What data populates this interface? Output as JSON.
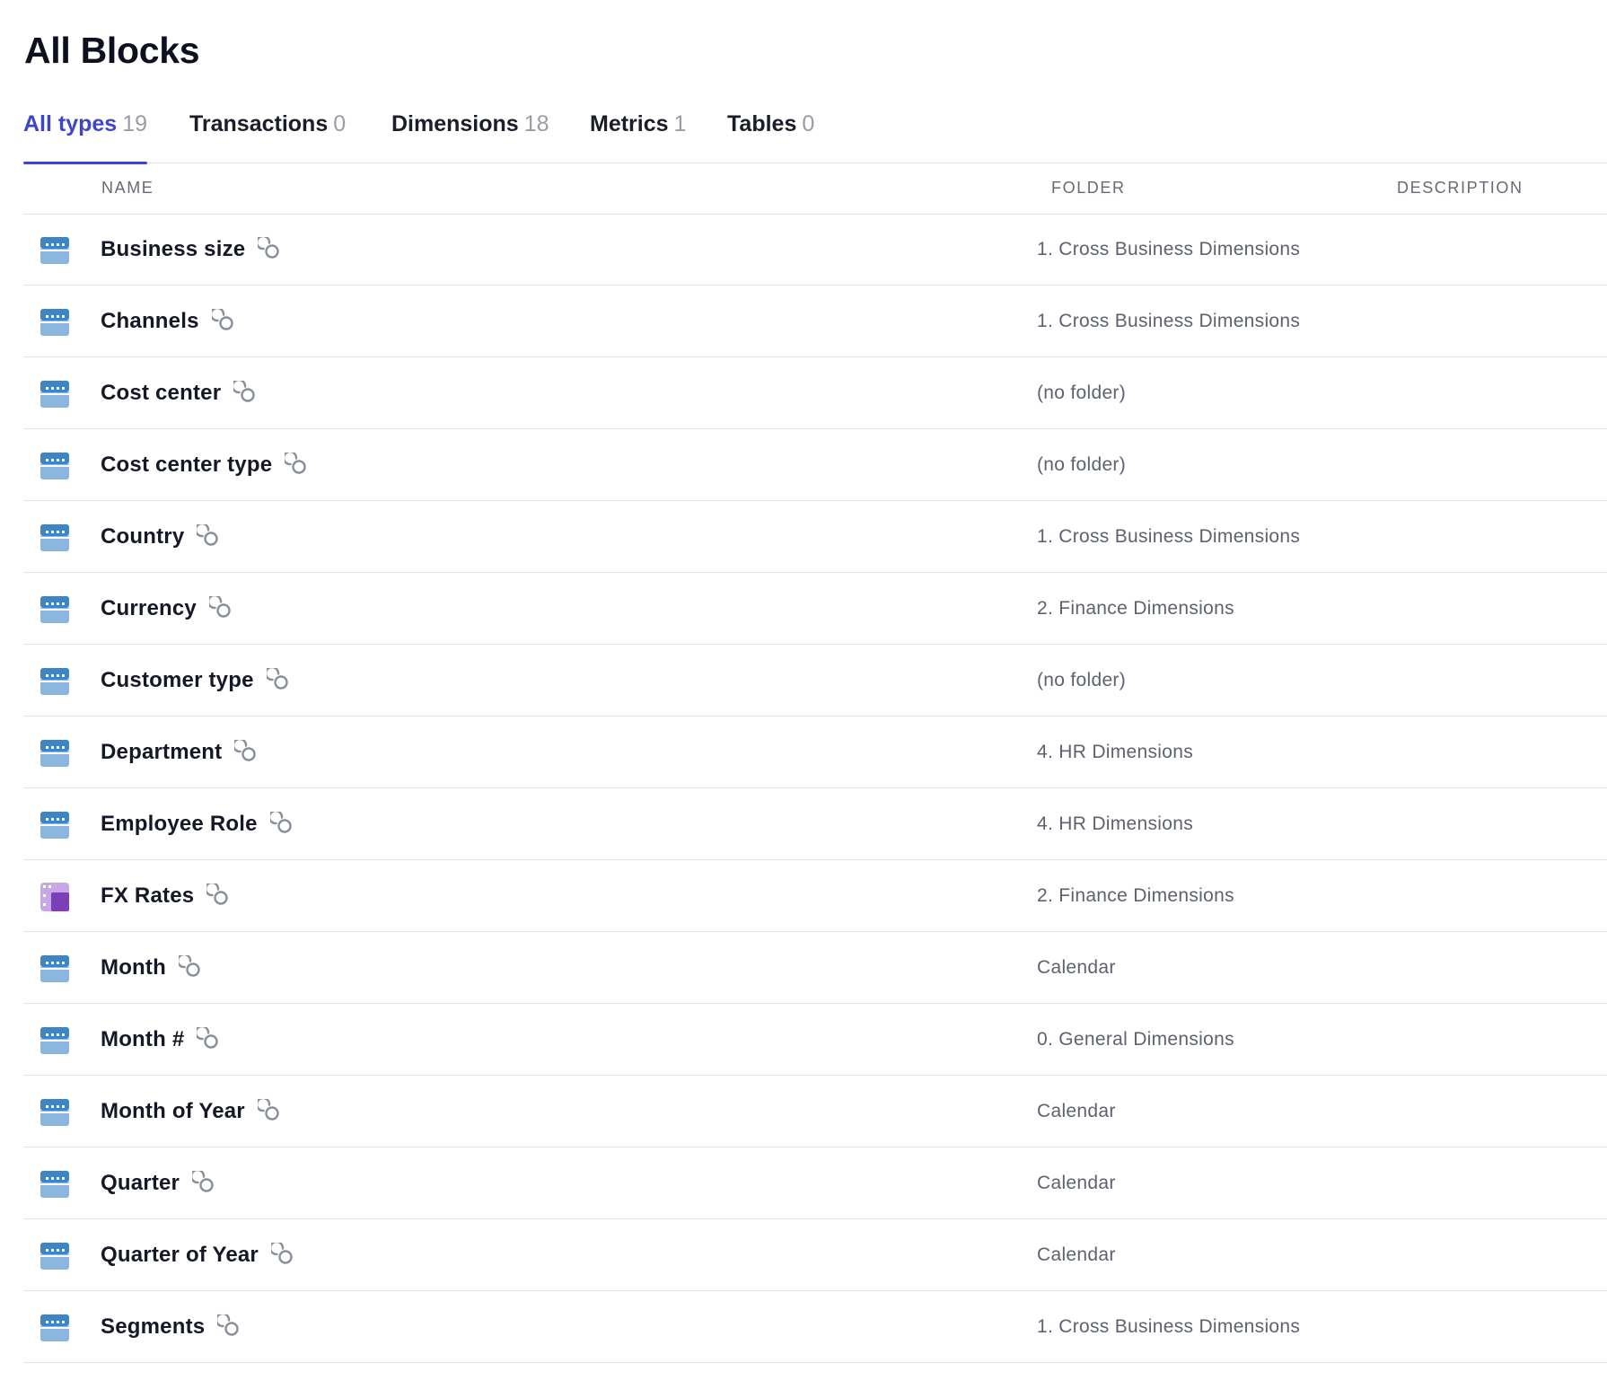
{
  "page": {
    "title": "All Blocks"
  },
  "tabs": [
    {
      "label": "All types",
      "count": "19",
      "active": true
    },
    {
      "label": "Transactions",
      "count": "0",
      "active": false
    },
    {
      "label": "Dimensions",
      "count": "18",
      "active": false
    },
    {
      "label": "Metrics",
      "count": "1",
      "active": false
    },
    {
      "label": "Tables",
      "count": "0",
      "active": false
    }
  ],
  "table": {
    "columns": {
      "name": "NAME",
      "folder": "FOLDER",
      "description": "DESCRIPTION"
    },
    "rows": [
      {
        "name": "Business size",
        "folder": "1. Cross Business Dimensions",
        "description": "",
        "icon": "dimension-icon"
      },
      {
        "name": "Channels",
        "folder": "1. Cross Business Dimensions",
        "description": "",
        "icon": "dimension-icon"
      },
      {
        "name": "Cost center",
        "folder": "(no folder)",
        "description": "",
        "icon": "dimension-icon"
      },
      {
        "name": "Cost center type",
        "folder": "(no folder)",
        "description": "",
        "icon": "dimension-icon"
      },
      {
        "name": "Country",
        "folder": "1. Cross Business Dimensions",
        "description": "",
        "icon": "dimension-icon"
      },
      {
        "name": "Currency",
        "folder": "2. Finance Dimensions",
        "description": "",
        "icon": "dimension-icon"
      },
      {
        "name": "Customer type",
        "folder": "(no folder)",
        "description": "",
        "icon": "dimension-icon"
      },
      {
        "name": "Department",
        "folder": "4. HR Dimensions",
        "description": "",
        "icon": "dimension-icon"
      },
      {
        "name": "Employee Role",
        "folder": "4. HR Dimensions",
        "description": "",
        "icon": "dimension-icon"
      },
      {
        "name": "FX Rates",
        "folder": "2. Finance Dimensions",
        "description": "",
        "icon": "metric-icon"
      },
      {
        "name": "Month",
        "folder": "Calendar",
        "description": "",
        "icon": "dimension-icon"
      },
      {
        "name": "Month #",
        "folder": "0. General Dimensions",
        "description": "",
        "icon": "dimension-icon"
      },
      {
        "name": "Month of Year",
        "folder": "Calendar",
        "description": "",
        "icon": "dimension-icon"
      },
      {
        "name": "Quarter",
        "folder": "Calendar",
        "description": "",
        "icon": "dimension-icon"
      },
      {
        "name": "Quarter of Year",
        "folder": "Calendar",
        "description": "",
        "icon": "dimension-icon"
      },
      {
        "name": "Segments",
        "folder": "1. Cross Business Dimensions",
        "description": "",
        "icon": "dimension-icon"
      }
    ]
  },
  "colors": {
    "accent": "#3e45c8",
    "dimension_icon_dark": "#3f84c3",
    "dimension_icon_light": "#8cb6dd",
    "metric_icon_dark": "#7b3fb8",
    "metric_icon_light": "#c9a6e8",
    "link_icon": "#8a8e99"
  }
}
